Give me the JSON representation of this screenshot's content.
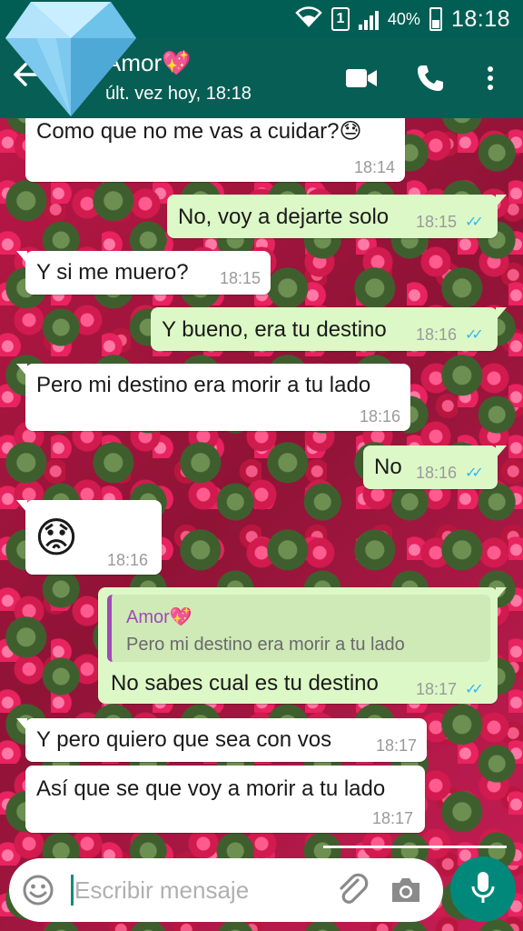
{
  "status_bar": {
    "sim": "1",
    "battery_percent": "40%",
    "time": "18:18",
    "icons": [
      "wifi-icon",
      "sim-icon",
      "signal-icon",
      "battery-icon"
    ]
  },
  "header": {
    "contact_name": "Amor💖",
    "last_seen": "últ. vez hoy, 18:18",
    "icons": [
      "back-arrow-icon",
      "video-call-icon",
      "phone-icon",
      "more-vert-icon"
    ]
  },
  "messages": [
    {
      "direction": "in",
      "text": "Como que no me vas a cuidar?😓",
      "time": "18:14"
    },
    {
      "direction": "out",
      "text": "No, voy a dejarte solo",
      "time": "18:15",
      "ticks": "✓✓"
    },
    {
      "direction": "in",
      "text": "Y si me muero?",
      "time": "18:15"
    },
    {
      "direction": "out",
      "text": "Y bueno, era tu destino",
      "time": "18:16",
      "ticks": "✓✓"
    },
    {
      "direction": "in",
      "text": "Pero mi destino era morir a tu lado",
      "time": "18:16"
    },
    {
      "direction": "out",
      "text": "No",
      "time": "18:16",
      "ticks": "✓✓"
    },
    {
      "direction": "in",
      "text": "😟",
      "time": "18:16"
    },
    {
      "direction": "out",
      "text": "No sabes cual es tu destino",
      "time": "18:17",
      "ticks": "✓✓",
      "quote": {
        "name": "Amor💖",
        "text": "Pero mi destino era morir a tu lado"
      }
    },
    {
      "direction": "in",
      "text": "Y pero quiero que sea con vos",
      "time": "18:17"
    },
    {
      "direction": "in",
      "text": "Así que se que voy a morir a tu lado",
      "time": "18:17"
    }
  ],
  "composer": {
    "placeholder": "Escribir mensaje",
    "icons": [
      "emoji-icon",
      "attach-icon",
      "camera-icon",
      "mic-icon"
    ]
  },
  "colors": {
    "header": "#075e54",
    "status_bar": "#005e54",
    "outgoing_bubble": "#dcf8c6",
    "incoming_bubble": "#ffffff",
    "read_ticks": "#34b7f1",
    "mic_button": "#00897b",
    "quote_accent": "#a14ab6"
  }
}
